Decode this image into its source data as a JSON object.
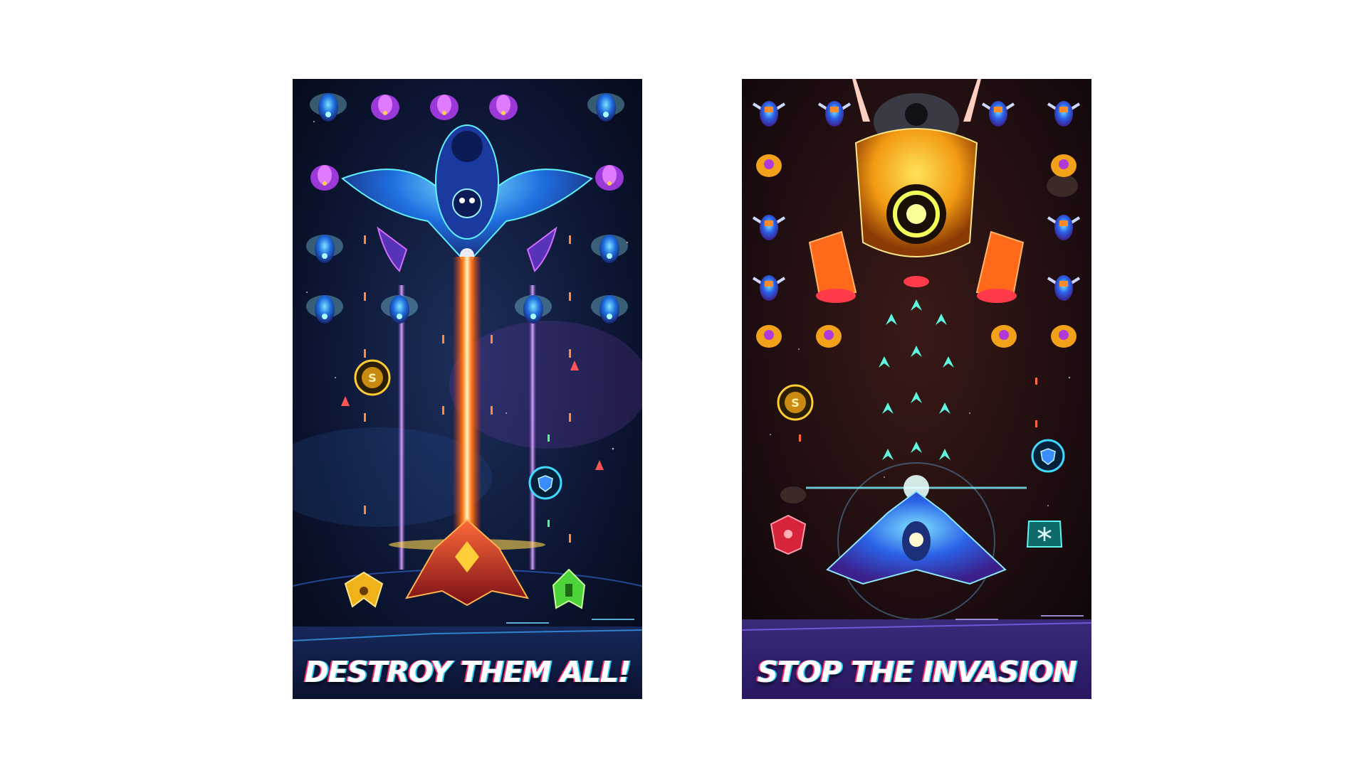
{
  "screens": [
    {
      "caption": "DESTROY  THEM ALL!",
      "pickups": [
        "S",
        "shield"
      ]
    },
    {
      "caption": "STOP THE INVASION",
      "pickups": [
        "S",
        "shield",
        "snowflake"
      ]
    }
  ],
  "colors": {
    "left_background": "#0b1430",
    "right_background": "#1e0d10",
    "laser": "#ff7a1a",
    "accent_cyan": "#39e6ff",
    "accent_purple": "#b24dff"
  }
}
